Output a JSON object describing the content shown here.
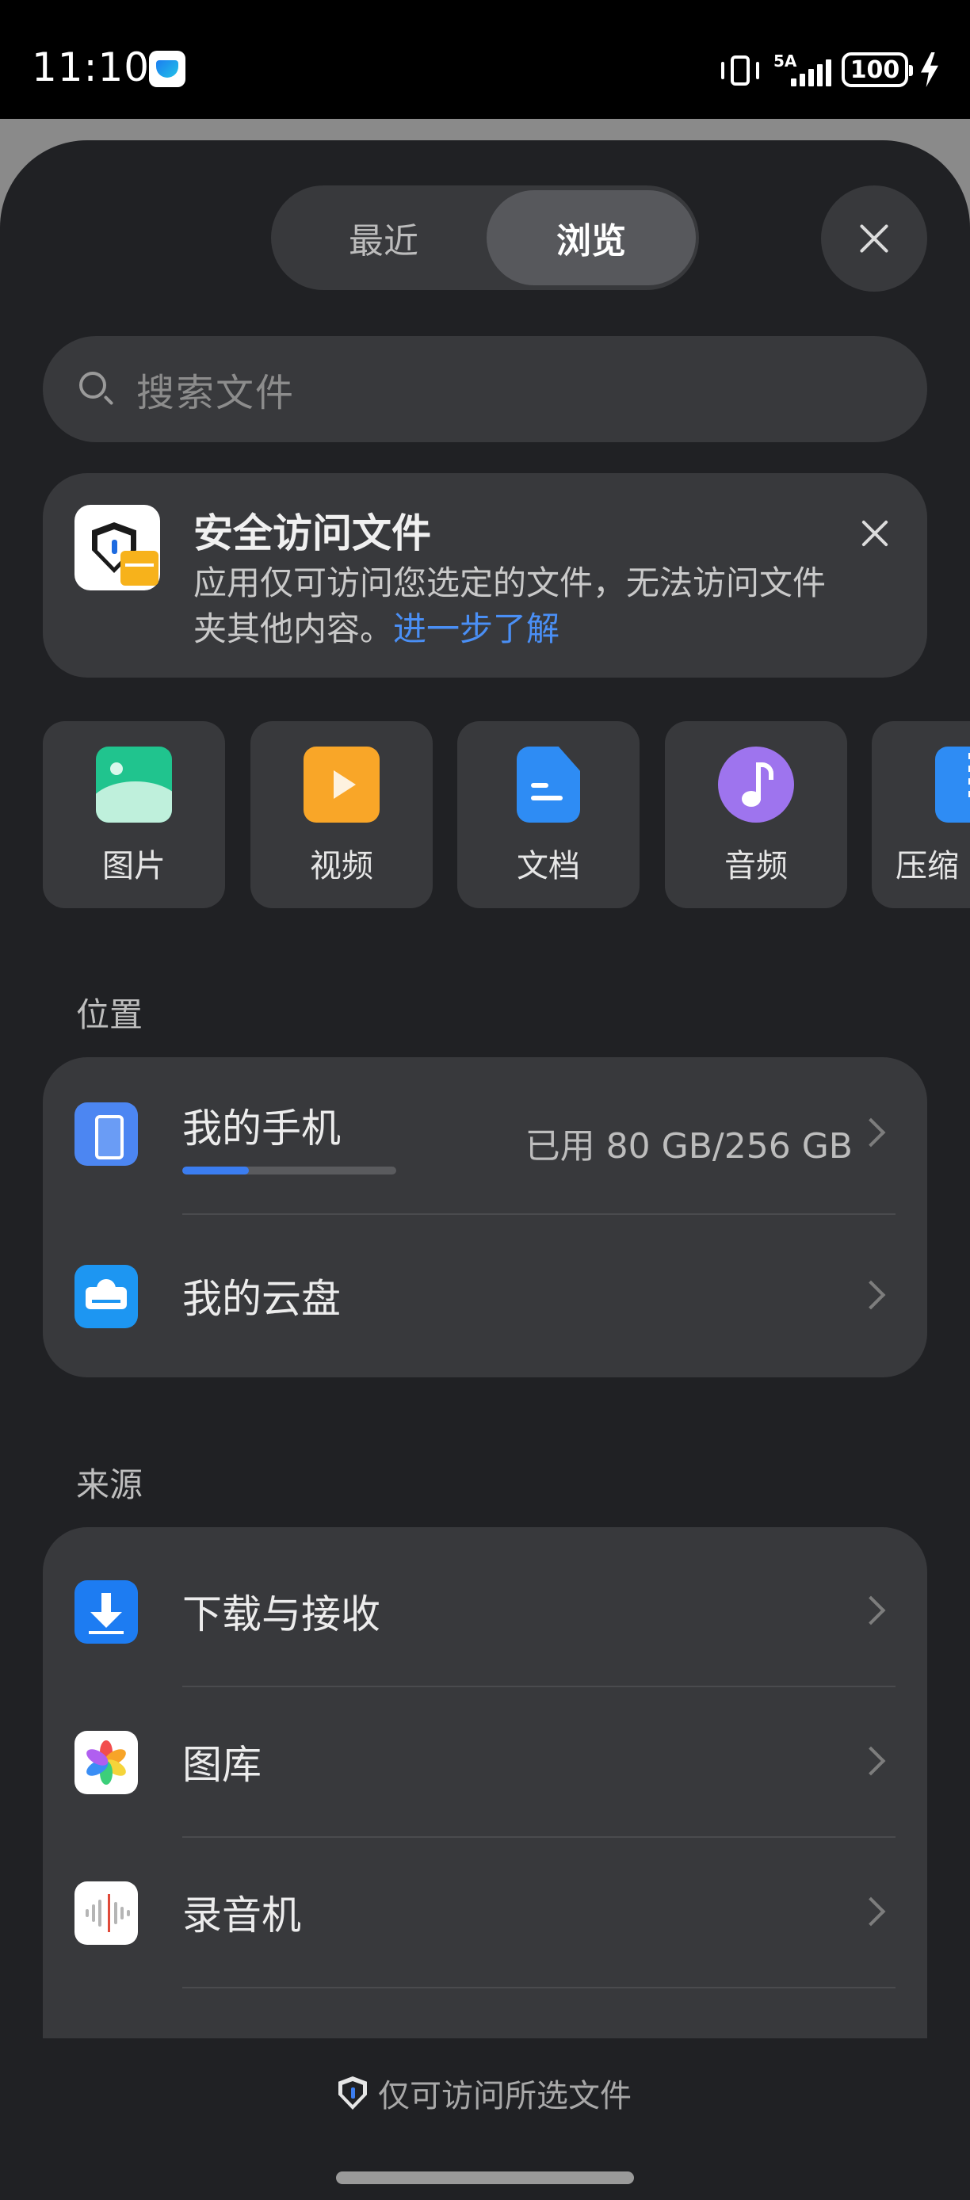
{
  "status_bar": {
    "time": "11:10",
    "network": "5A",
    "battery": "100",
    "icons": [
      "app-notification-icon",
      "vibrate-icon",
      "signal-icon",
      "battery-icon",
      "charging-icon"
    ]
  },
  "header": {
    "tabs": [
      {
        "label": "最近",
        "selected": false
      },
      {
        "label": "浏览",
        "selected": true
      }
    ],
    "close_icon": "close-icon"
  },
  "search": {
    "placeholder": "搜索文件",
    "icon": "search-icon"
  },
  "notice": {
    "title": "安全访问文件",
    "body": "应用仅可访问您选定的文件，无法访问文件夹其他内容。",
    "link": "进一步了解",
    "icon": "secure-file-icon",
    "close_icon": "close-icon"
  },
  "categories": [
    {
      "label": "图片",
      "icon": "image-icon",
      "color": "#20c48e"
    },
    {
      "label": "视频",
      "icon": "video-icon",
      "color": "#f9a628"
    },
    {
      "label": "文档",
      "icon": "document-icon",
      "color": "#2e8cf4"
    },
    {
      "label": "音频",
      "icon": "audio-icon",
      "color": "#9e74ee"
    },
    {
      "label": "压缩",
      "icon": "archive-icon",
      "color": "#2e8cf4"
    }
  ],
  "locations": {
    "title": "位置",
    "items": [
      {
        "label": "我的手机",
        "detail": "已用 80 GB/256 GB",
        "usage_fraction": 0.3125,
        "icon": "phone-icon"
      },
      {
        "label": "我的云盘",
        "icon": "cloud-drive-icon"
      }
    ]
  },
  "sources": {
    "title": "来源",
    "items": [
      {
        "label": "下载与接收",
        "icon": "download-icon"
      },
      {
        "label": "图库",
        "icon": "gallery-icon"
      },
      {
        "label": "录音机",
        "icon": "recorder-icon"
      }
    ]
  },
  "footer": {
    "note": "仅可访问所选文件",
    "icon": "shield-icon"
  },
  "colors": {
    "sheet_background": "#202124",
    "card_background": "#38393c",
    "accent": "#3b7df0",
    "link": "#4a8ff5"
  }
}
